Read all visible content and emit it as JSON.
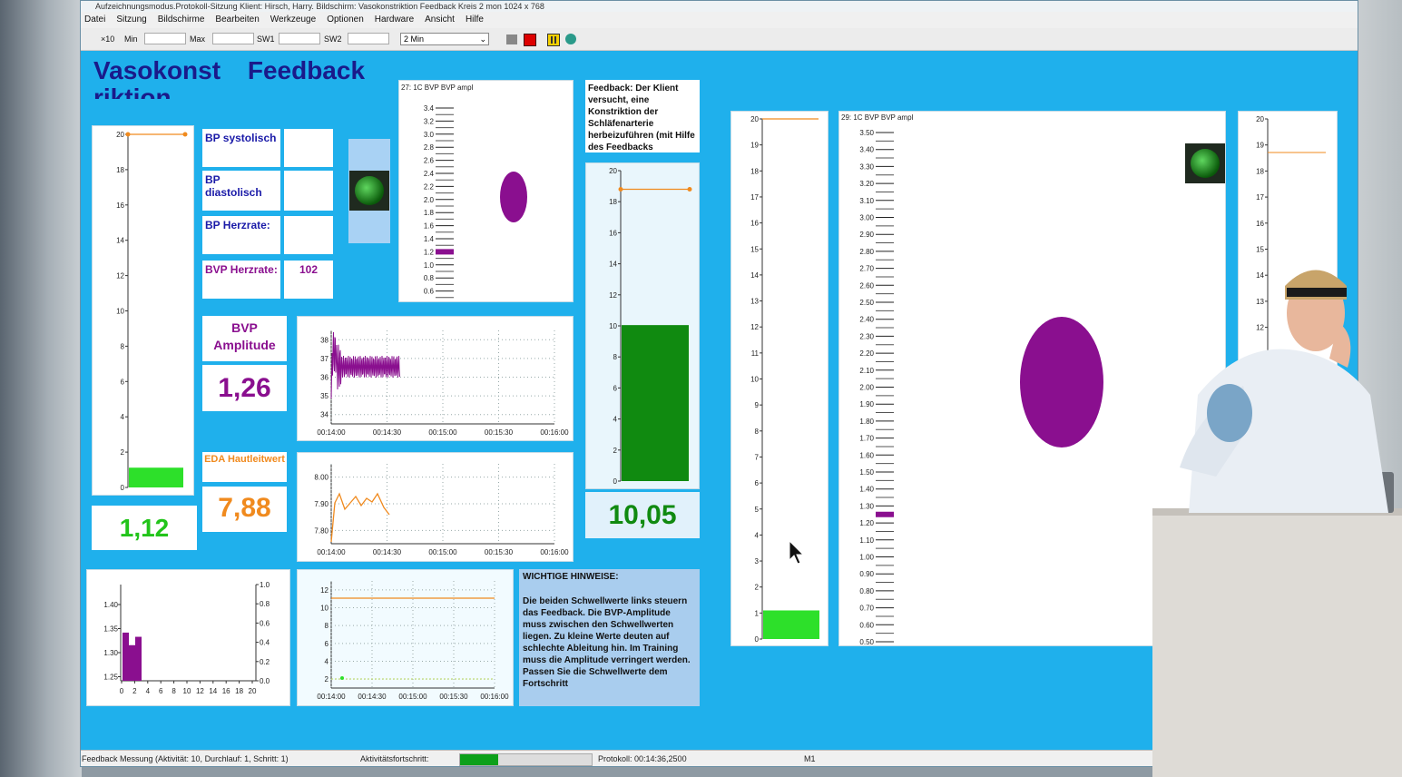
{
  "window": {
    "title": "Aufzeichnungsmodus.Protokoll-Sitzung Klient: Hirsch, Harry. Bildschirm: Vasokonstriktion Feedback Kreis 2 mon 1024 x 768"
  },
  "menu": [
    "Datei",
    "Sitzung",
    "Bildschirme",
    "Bearbeiten",
    "Werkzeuge",
    "Optionen",
    "Hardware",
    "Ansicht",
    "Hilfe"
  ],
  "toolbar": {
    "x10": "×10",
    "min_label": "Min",
    "max_label": "Max",
    "sw1_label": "SW1",
    "sw2_label": "SW2",
    "timeframe": "2 Min"
  },
  "title": {
    "line1": "Vasokonst",
    "line2": "Feedback",
    "line3": "riktion"
  },
  "labels": {
    "bp_sys": "BP systolisch",
    "bp_dia": "BP diastolisch",
    "bp_hr": "BP Herzrate:",
    "bvp_hr": "BVP Herzrate:",
    "bvp_hr_value": "102",
    "bvp_amp_title": "BVP Amplitude",
    "bvp_amp_value": "1,26",
    "eda_title": "EDA Hautleitwert",
    "eda_value": "7,88",
    "left_value": "1,12",
    "green_value": "10,05"
  },
  "feedback_note": "Feedback: Der Klient versucht, eine Konstriktion der Schläfenarterie herbeizuführen (mit Hilfe des Feedbacks",
  "notes": {
    "title": "WICHTIGE HINWEISE:",
    "body": "Die beiden Schwellwerte links steuern das Feedback. Die BVP-Amplitude muss zwischen den Schwellwerten liegen. Zu kleine Werte deuten auf schlechte Ableitung hin. Im Training muss die Amplitude verringert werden. Passen Sie die Schwellwerte dem Fortschritt"
  },
  "scale1": {
    "title": "27: 1C BVP BVP ampl",
    "ticks": [
      "3.4",
      "3.2",
      "3.0",
      "2.8",
      "2.6",
      "2.4",
      "2.2",
      "2.0",
      "1.8",
      "1.6",
      "1.4",
      "1.2",
      "1.0",
      "0.8",
      "0.6"
    ]
  },
  "scale2": {
    "title": "29: 1C BVP BVP ampl",
    "ticks": [
      "3.50",
      "3.40",
      "3.30",
      "3.20",
      "3.10",
      "3.00",
      "2.90",
      "2.80",
      "2.70",
      "2.60",
      "2.50",
      "2.40",
      "2.30",
      "2.20",
      "2.10",
      "2.00",
      "1.90",
      "1.80",
      "1.70",
      "1.60",
      "1.50",
      "1.40",
      "1.30",
      "1.20",
      "1.10",
      "1.00",
      "0.90",
      "0.80",
      "0.70",
      "0.60",
      "0.50"
    ]
  },
  "status": {
    "left": "Feedback Messung (Aktivität: 10, Durchlauf: 1, Schritt: 1)",
    "progress_label": "Aktivitätsfortschritt:",
    "progress": 0.29,
    "protocol": "Protokoll: 00:14:36,2500",
    "m1": "M1"
  },
  "colors": {
    "bg": "#1fb0ec",
    "green": "#2de02a",
    "darkgreen": "#108a10",
    "purple": "#8a0f8f",
    "orange": "#f08a1e",
    "label": "#1a1aa8"
  },
  "chart_data": [
    {
      "type": "bar",
      "id": "left-bar",
      "categories": [
        ""
      ],
      "values": [
        1.12
      ],
      "ylim": [
        0,
        20
      ],
      "ticks": [
        "0",
        "2",
        "4",
        "6",
        "8",
        "10",
        "12",
        "14",
        "16",
        "18",
        "20"
      ],
      "threshold": 20
    },
    {
      "type": "bar",
      "id": "green-bar",
      "categories": [
        ""
      ],
      "values": [
        10.05
      ],
      "ylim": [
        0,
        20
      ],
      "ticks": [
        "0",
        "2",
        "4",
        "6",
        "8",
        "10",
        "12",
        "14",
        "16",
        "18",
        "20"
      ],
      "threshold": 18.8
    },
    {
      "type": "line",
      "id": "bvp-amplitude-trend",
      "xlabels": [
        "00:14:00",
        "00:14:30",
        "00:15:00",
        "00:15:30",
        "00:16:00"
      ],
      "yticks": [
        "38",
        "37",
        "36",
        "35",
        "34"
      ],
      "ylim": [
        33.5,
        38.5
      ]
    },
    {
      "type": "line",
      "id": "eda-trend",
      "xlabels": [
        "00:14:00",
        "00:14:30",
        "00:15:00",
        "00:15:30",
        "00:16:00"
      ],
      "yticks": [
        "8.00",
        "7.90",
        "7.80"
      ],
      "ylim": [
        7.78,
        8.02
      ]
    },
    {
      "type": "line",
      "id": "threshold-trend",
      "xlabels": [
        "00:14:00",
        "00:14:30",
        "00:15:00",
        "00:15:30",
        "00:16:00"
      ],
      "yticks": [
        "12",
        "10",
        "8",
        "6",
        "4",
        "2"
      ],
      "ylim": [
        1,
        12
      ]
    },
    {
      "type": "bar",
      "id": "histogram",
      "xticks": [
        "0",
        "2",
        "4",
        "6",
        "8",
        "10",
        "12",
        "14",
        "16",
        "18",
        "20"
      ],
      "yticks_left": [
        "1.40",
        "1.35",
        "1.30",
        "1.25"
      ],
      "yticks_right": [
        "1.0",
        "0.8",
        "0.6",
        "0.4",
        "0.2",
        "0.0"
      ],
      "values": [
        1.35,
        1.32,
        1.34
      ]
    },
    {
      "type": "bar",
      "id": "right-bar",
      "categories": [
        ""
      ],
      "values": [
        1.1
      ],
      "ylim": [
        0,
        20
      ],
      "ticks": [
        "0",
        "1",
        "2",
        "3",
        "4",
        "5",
        "6",
        "7",
        "8",
        "9",
        "10",
        "11",
        "12",
        "13",
        "14",
        "15",
        "16",
        "17",
        "18",
        "19",
        "20"
      ],
      "threshold": 20
    },
    {
      "type": "bar",
      "id": "far-right-bar",
      "ticks": [
        "20",
        "19",
        "18",
        "17",
        "16",
        "15",
        "14",
        "13",
        "12"
      ]
    }
  ]
}
